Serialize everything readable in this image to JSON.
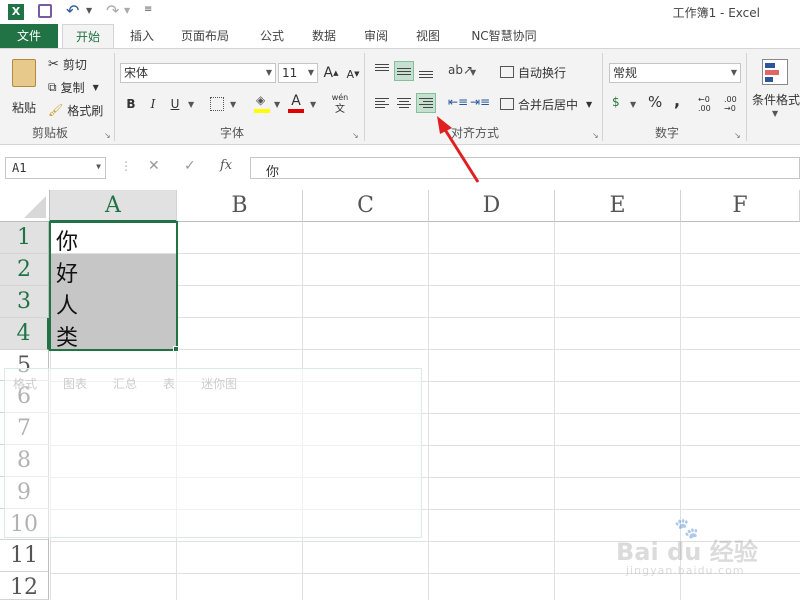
{
  "window": {
    "title": "工作簿1 - Excel"
  },
  "tabs": [
    "文件",
    "开始",
    "插入",
    "页面布局",
    "公式",
    "数据",
    "审阅",
    "视图",
    "NC智慧协同"
  ],
  "ribbon": {
    "clipboard": {
      "paste": "粘贴",
      "cut": "剪切",
      "copy": "复制",
      "format_painter": "格式刷",
      "label": "剪贴板"
    },
    "font": {
      "name": "宋体",
      "size": "11",
      "grow": "A",
      "shrink": "A",
      "bold": "B",
      "italic": "I",
      "underline": "U",
      "color_letter": "A",
      "phonetic": "wén",
      "phonetic_sub": "文",
      "label": "字体"
    },
    "alignment": {
      "wrap": "自动换行",
      "merge": "合并后居中",
      "label": "对齐方式"
    },
    "number": {
      "format": "常规",
      "currency": "$",
      "percent": "%",
      "comma": ",",
      "inc_dec": "←0 .00",
      "dec_dec": ".00 →0",
      "label": "数字"
    },
    "styles": {
      "cond_format": "条件格式"
    }
  },
  "formula_bar": {
    "name_box": "A1",
    "cancel": "✕",
    "enter": "✓",
    "fx": "fx",
    "value": "你"
  },
  "columns": [
    "A",
    "B",
    "C",
    "D",
    "E",
    "F"
  ],
  "rows": [
    "1",
    "2",
    "3",
    "4",
    "5",
    "6",
    "7",
    "8",
    "9",
    "10",
    "11",
    "12"
  ],
  "cells": {
    "A1": "你",
    "A2": "好",
    "A3": "人",
    "A4": "类"
  },
  "quick_analysis": {
    "tabs": [
      "格式",
      "图表",
      "汇总",
      "表",
      "迷你图"
    ]
  },
  "watermark": {
    "logo": "Bai du 经验",
    "url": "jingyan.baidu.com"
  }
}
